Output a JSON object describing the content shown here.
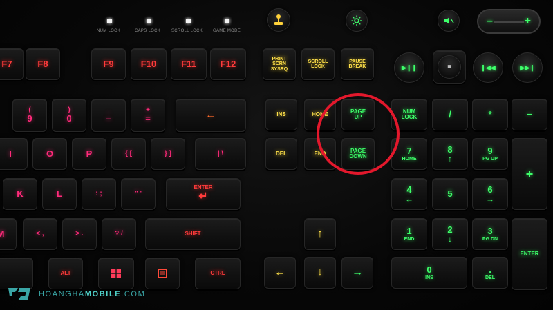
{
  "leds": [
    {
      "label": "NUM LOCK"
    },
    {
      "label": "CAPS LOCK"
    },
    {
      "label": "SCROLL LOCK"
    },
    {
      "label": "GAME MODE"
    }
  ],
  "top_buttons": {
    "game_icon": "joystick-icon",
    "light_icon": "sun-icon",
    "mute_icon": "mute-icon",
    "volume": {
      "minus": "–",
      "plus": "+"
    }
  },
  "function_keys": [
    "F7",
    "F8",
    "F9",
    "F10",
    "F11",
    "F12"
  ],
  "system_keys": {
    "print": "PRINT SCRN SYSRQ",
    "scroll": "SCROLL LOCK",
    "pause": "PAUSE BREAK"
  },
  "media_keys": {
    "play_pause": "▶❙❙",
    "stop": "■",
    "prev": "❙◀◀",
    "next": "▶▶❙"
  },
  "number_row": [
    {
      "top": "(",
      "bottom": "9"
    },
    {
      "top": ")",
      "bottom": "0"
    },
    {
      "top": "_",
      "bottom": "–"
    },
    {
      "top": "+",
      "bottom": "="
    }
  ],
  "backspace": "←",
  "nav_keys": {
    "ins": "INS",
    "home": "HOME",
    "page_up": "PAGE UP",
    "del": "DEL",
    "end": "END",
    "page_down": "PAGE DOWN"
  },
  "numpad": {
    "numlock": "NUM LOCK",
    "slash": "/",
    "star": "*",
    "minus": "–",
    "plus": "+",
    "n7": "7",
    "n7sub": "HOME",
    "n8": "8",
    "n8sub": "↑",
    "n9": "9",
    "n9sub": "PG UP",
    "n4": "4",
    "n4sub": "←",
    "n5": "5",
    "n6": "6",
    "n6sub": "→",
    "n1": "1",
    "n1sub": "END",
    "n2": "2",
    "n2sub": "↓",
    "n3": "3",
    "n3sub": "PG DN",
    "n0": "0",
    "n0sub": "INS",
    "dot": ".",
    "dotsub": "DEL",
    "enter": "ENTER"
  },
  "qwerty_row": [
    "I",
    "O",
    "P",
    "{ [",
    "} ]",
    "| \\"
  ],
  "home_row": [
    "K",
    "L",
    ": ;",
    "\" '"
  ],
  "enter": "ENTER",
  "enter_arrow": "↵",
  "bottom_row": [
    "M",
    "< ,",
    "> .",
    "? /"
  ],
  "shift": "SHIFT",
  "mod_row": {
    "alt": "ALT",
    "win": "windows-icon",
    "menu": "menu-icon",
    "ctrl": "CTRL"
  },
  "arrows": {
    "up": "↑",
    "left": "←",
    "down": "↓",
    "right": "→"
  },
  "watermark": {
    "brand_a": "HOANGHA",
    "brand_b": "MOBILE",
    "brand_c": ".COM"
  },
  "colors": {
    "highlight_circle": "#e3182c",
    "numpad_green": "#3dff6a",
    "nav_yellow": "#ffe14a",
    "main_pink": "#ff2a7a"
  }
}
